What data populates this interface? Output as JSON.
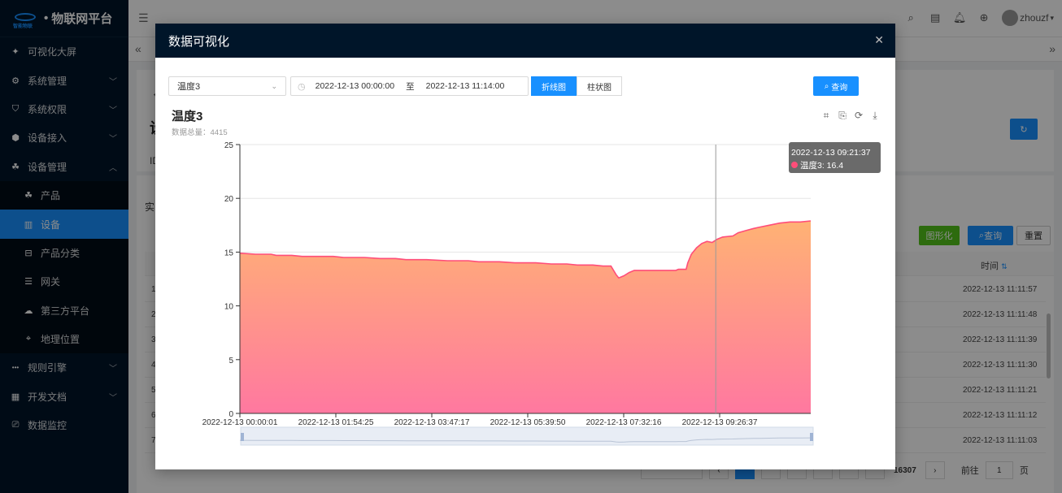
{
  "app": {
    "brand": "物联网平台",
    "logo_text": "智能物联"
  },
  "sidebar": {
    "items": [
      {
        "label": "可视化大屏",
        "icon": "sparkle-icon"
      },
      {
        "label": "系统管理",
        "icon": "gear-icon"
      },
      {
        "label": "系统权限",
        "icon": "shield-icon"
      },
      {
        "label": "设备接入",
        "icon": "cube-icon"
      },
      {
        "label": "设备管理",
        "icon": "cluster-icon"
      }
    ],
    "sub_items": [
      {
        "label": "产品",
        "icon": "cluster-icon"
      },
      {
        "label": "设备",
        "icon": "columns-icon"
      },
      {
        "label": "产品分类",
        "icon": "category-icon"
      },
      {
        "label": "网关",
        "icon": "list-icon"
      },
      {
        "label": "第三方平台",
        "icon": "cloud-icon"
      },
      {
        "label": "地理位置",
        "icon": "location-icon"
      }
    ],
    "bottom_items": [
      {
        "label": "规则引擎",
        "icon": "dots-icon"
      },
      {
        "label": "开发文档",
        "icon": "doc-icon"
      },
      {
        "label": "数据监控",
        "icon": "monitor-icon"
      }
    ]
  },
  "header": {
    "username": "zhouzf"
  },
  "background": {
    "title_cut": "设",
    "id_cut": "ID:",
    "tab_cut": "实",
    "btn_visualize": "图形化",
    "btn_query": "查询",
    "btn_reset": "重置",
    "col_time": "时间",
    "rows": [
      {
        "idx": "1",
        "time": "2022-12-13 11:11:57"
      },
      {
        "idx": "2",
        "time": "2022-12-13 11:11:48"
      },
      {
        "idx": "3",
        "time": "2022-12-13 11:11:39"
      },
      {
        "idx": "4",
        "time": "2022-12-13 11:11:30"
      },
      {
        "idx": "5",
        "time": "2022-12-13 11:11:21"
      },
      {
        "idx": "6",
        "time": "2022-12-13 11:11:12"
      },
      {
        "idx": "7",
        "time": "2022-12-13 11:11:03"
      }
    ],
    "pager_total": "16307",
    "pager_goto": "前往",
    "pager_page": "1",
    "pager_unit": "页"
  },
  "modal": {
    "title": "数据可视化",
    "select_value": "温度3",
    "date_start": "2022-12-13 00:00:00",
    "date_sep": "至",
    "date_end": "2022-12-13 11:14:00",
    "seg_line": "折线图",
    "seg_bar": "柱状图",
    "query": "查询",
    "chart_title": "温度3",
    "chart_sub": "数据总量：4415",
    "tooltip_time": "2022-12-13 09:21:37",
    "tooltip_value": "温度3: 16.4"
  },
  "chart_data": {
    "type": "area",
    "title": "温度3",
    "series": [
      {
        "name": "温度3"
      }
    ],
    "ylim": [
      0,
      25
    ],
    "y_ticks": [
      "0",
      "5",
      "10",
      "15",
      "20",
      "25"
    ],
    "x_ticks": [
      "2022-12-13 00:00:01",
      "2022-12-13 01:54:25",
      "2022-12-13 03:47:17",
      "2022-12-13 05:39:50",
      "2022-12-13 07:32:16",
      "2022-12-13 09:26:37"
    ],
    "points": [
      [
        0.0,
        14.9
      ],
      [
        0.03,
        14.8
      ],
      [
        0.06,
        14.8
      ],
      [
        0.07,
        14.7
      ],
      [
        0.1,
        14.7
      ],
      [
        0.12,
        14.6
      ],
      [
        0.15,
        14.6
      ],
      [
        0.18,
        14.6
      ],
      [
        0.2,
        14.5
      ],
      [
        0.24,
        14.5
      ],
      [
        0.27,
        14.4
      ],
      [
        0.3,
        14.4
      ],
      [
        0.32,
        14.3
      ],
      [
        0.36,
        14.3
      ],
      [
        0.4,
        14.2
      ],
      [
        0.44,
        14.2
      ],
      [
        0.46,
        14.1
      ],
      [
        0.5,
        14.1
      ],
      [
        0.53,
        14.0
      ],
      [
        0.57,
        14.0
      ],
      [
        0.6,
        13.9
      ],
      [
        0.63,
        13.9
      ],
      [
        0.65,
        13.8
      ],
      [
        0.68,
        13.8
      ],
      [
        0.7,
        13.7
      ],
      [
        0.715,
        13.7
      ],
      [
        0.725,
        12.9
      ],
      [
        0.73,
        12.6
      ],
      [
        0.74,
        12.8
      ],
      [
        0.75,
        13.1
      ],
      [
        0.76,
        13.3
      ],
      [
        0.79,
        13.3
      ],
      [
        0.82,
        13.3
      ],
      [
        0.84,
        13.3
      ],
      [
        0.845,
        13.4
      ],
      [
        0.86,
        13.4
      ],
      [
        0.863,
        14.0
      ],
      [
        0.87,
        14.8
      ],
      [
        0.88,
        15.4
      ],
      [
        0.89,
        15.8
      ],
      [
        0.9,
        16.0
      ],
      [
        0.91,
        15.9
      ],
      [
        0.92,
        16.2
      ],
      [
        0.93,
        16.4
      ],
      [
        0.95,
        16.5
      ],
      [
        0.96,
        16.8
      ],
      [
        0.975,
        17.0
      ],
      [
        0.99,
        17.2
      ],
      [
        1.0,
        17.3
      ],
      [
        1.02,
        17.5
      ],
      [
        1.04,
        17.7
      ],
      [
        1.06,
        17.8
      ],
      [
        1.08,
        17.8
      ],
      [
        1.1,
        17.9
      ]
    ],
    "x_range": [
      0,
      1.1
    ],
    "cursor_x": 0.917,
    "tooltip": {
      "time": "2022-12-13 09:21:37",
      "value": 16.4
    },
    "total": 4415,
    "line_color": "#ff4d79",
    "fill_top": "#ffb274",
    "fill_bottom": "#ff78a0"
  }
}
